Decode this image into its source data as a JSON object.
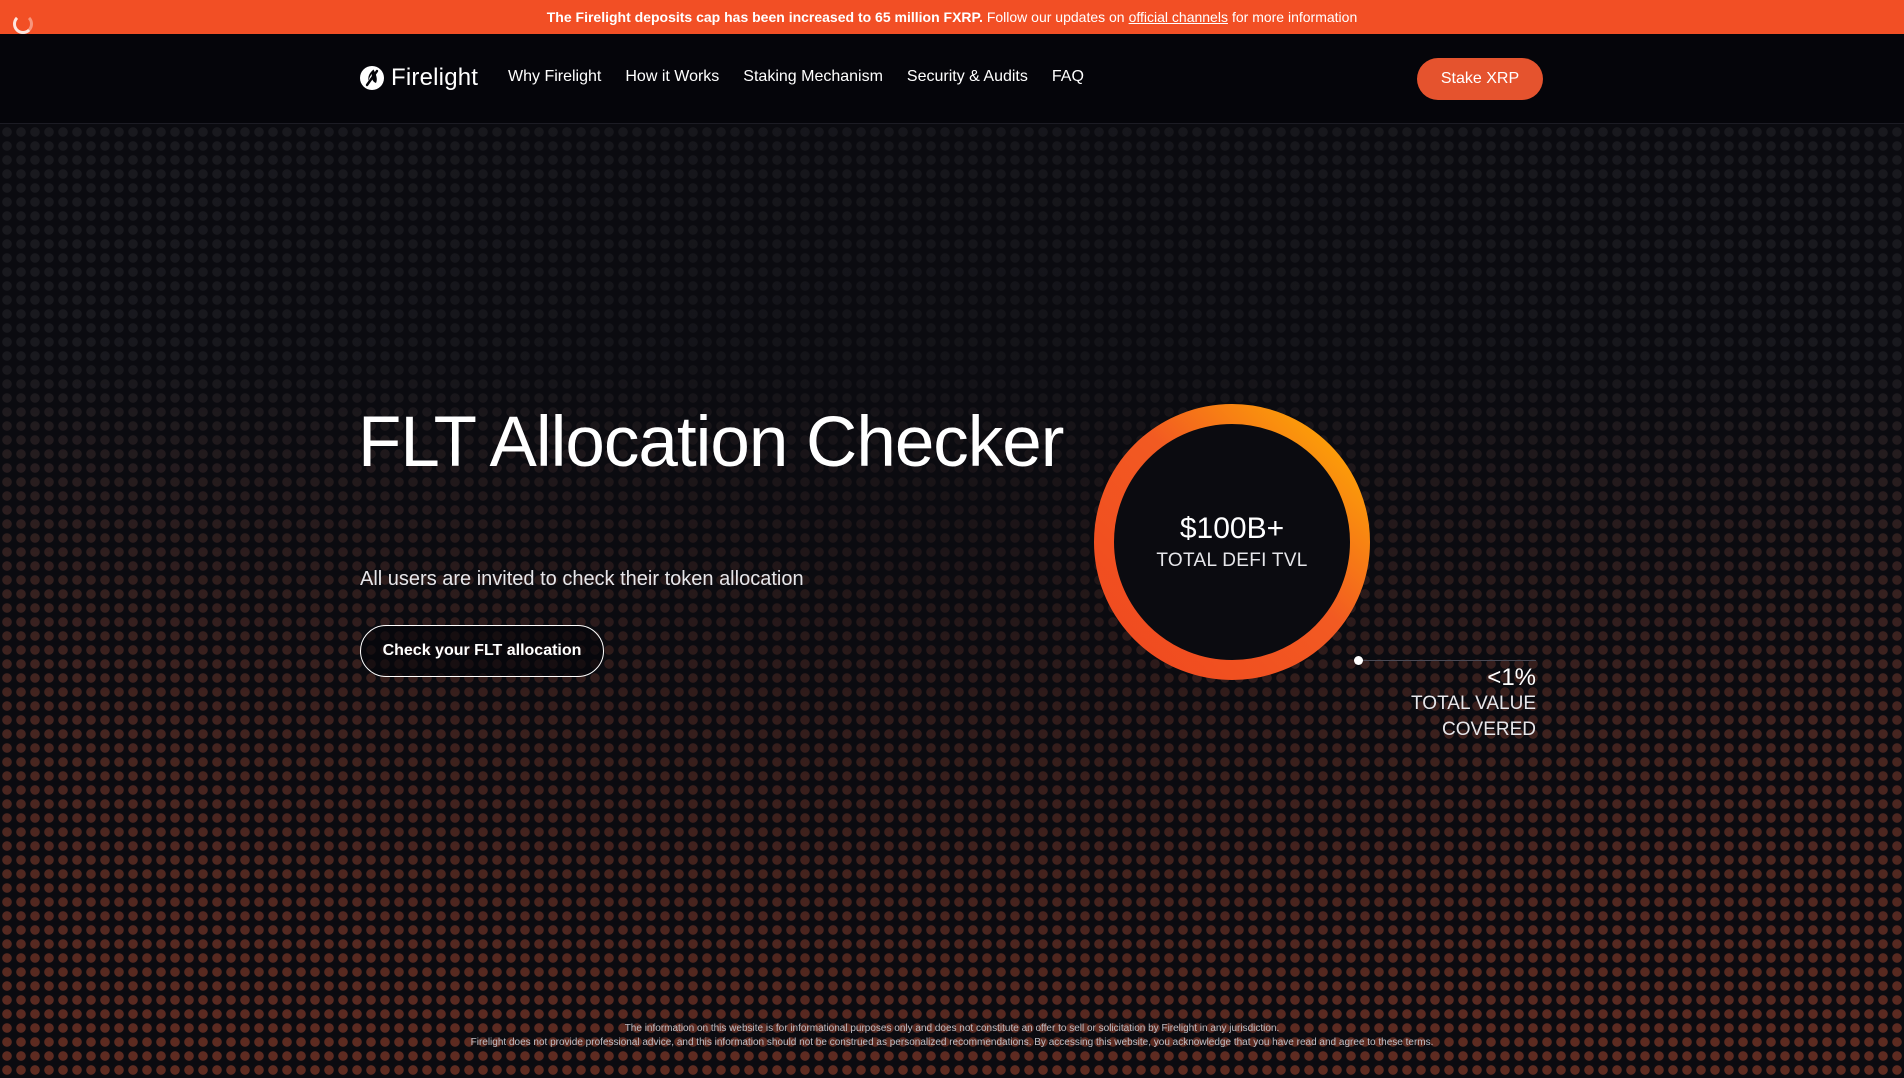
{
  "banner": {
    "strong_text": "The Firelight deposits cap has been increased to 65 million FXRP.",
    "text": "Follow our updates on",
    "link": "official channels",
    "suffix": "for more information"
  },
  "nav": {
    "brand": "Firelight",
    "links": [
      "Why Firelight",
      "How it Works",
      "Staking Mechanism",
      "Security & Audits",
      "FAQ"
    ],
    "cta": "Stake XRP"
  },
  "hero": {
    "title": "FLT Allocation Checker",
    "subtitle": "All users are invited to check their token allocation",
    "button": "Check your FLT allocation"
  },
  "stats": {
    "ring_value": "$100B+",
    "ring_label": "TOTAL DEFI TVL",
    "side_value": "<1%",
    "side_label_line1": "TOTAL VALUE",
    "side_label_line2": "COVERED"
  },
  "disclaimer": {
    "line1": "The information on this website is for informational purposes only and does not constitute an offer to sell or solicitation by Firelight in any jurisdiction.",
    "line2": "Firelight does not provide professional advice, and this information should not be construed as personalized recommendations. By accessing this website, you acknowledge that you have read and agree to these terms."
  },
  "colors": {
    "banner": "#f24f25",
    "accent": "#e5532e",
    "ring_start": "#f0481f",
    "ring_end": "#ffb300",
    "background": "#0b0b10"
  },
  "icons": {
    "brand": "flame-logo-icon",
    "loader": "loading-spinner-icon"
  }
}
